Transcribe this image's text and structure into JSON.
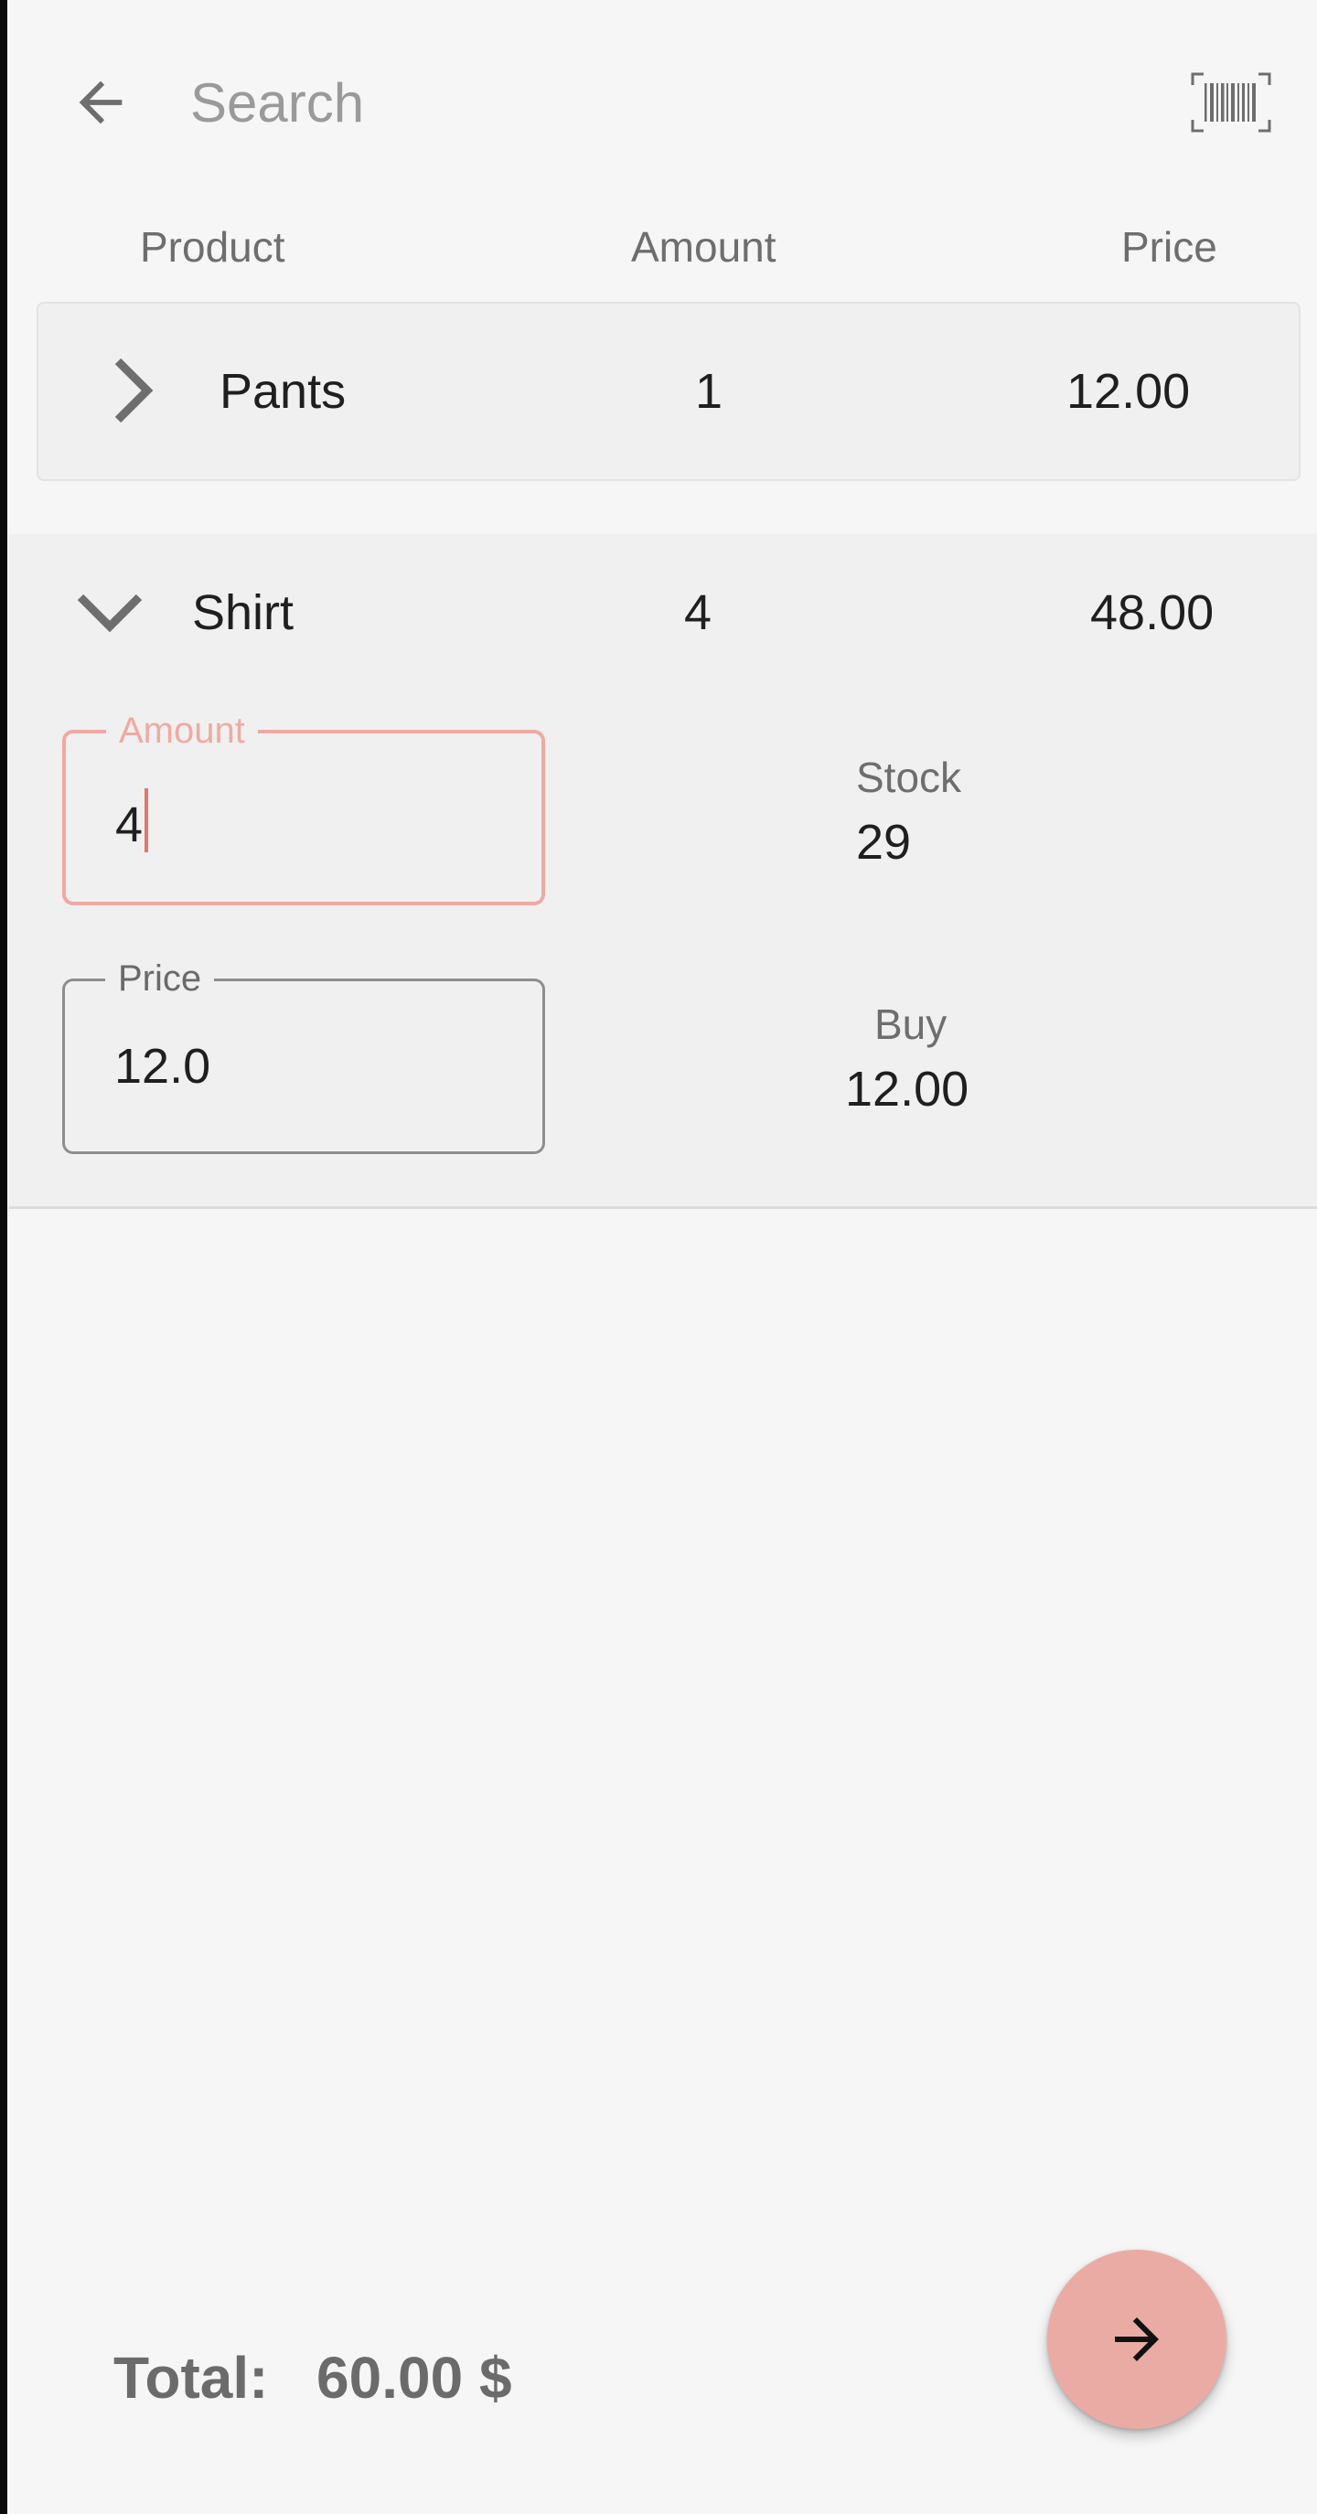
{
  "search": {
    "placeholder": "Search",
    "value": ""
  },
  "icons": {
    "back": "arrow-left-icon",
    "barcode": "barcode-scan-icon",
    "expand": "chevron-right-icon",
    "collapse": "chevron-down-icon",
    "next": "arrow-right-icon"
  },
  "columns": {
    "product": "Product",
    "amount": "Amount",
    "price": "Price"
  },
  "items": [
    {
      "name": "Pants",
      "amount": "1",
      "price": "12.00",
      "expanded": false
    },
    {
      "name": "Shirt",
      "amount": "4",
      "price": "48.00",
      "expanded": true,
      "amount_field_label": "Amount",
      "amount_field_value": "4",
      "price_field_label": "Price",
      "price_field_value": "12.0",
      "stock_label": "Stock",
      "stock_value": "29",
      "buy_label": "Buy",
      "buy_value": "12.00"
    }
  ],
  "footer": {
    "total_label": "Total:",
    "total_value": "60.00 $"
  },
  "colors": {
    "accent": "#efaaa4",
    "fab": "#ebaba5",
    "background": "#f6f6f6",
    "row_background": "#f0f0f0"
  }
}
